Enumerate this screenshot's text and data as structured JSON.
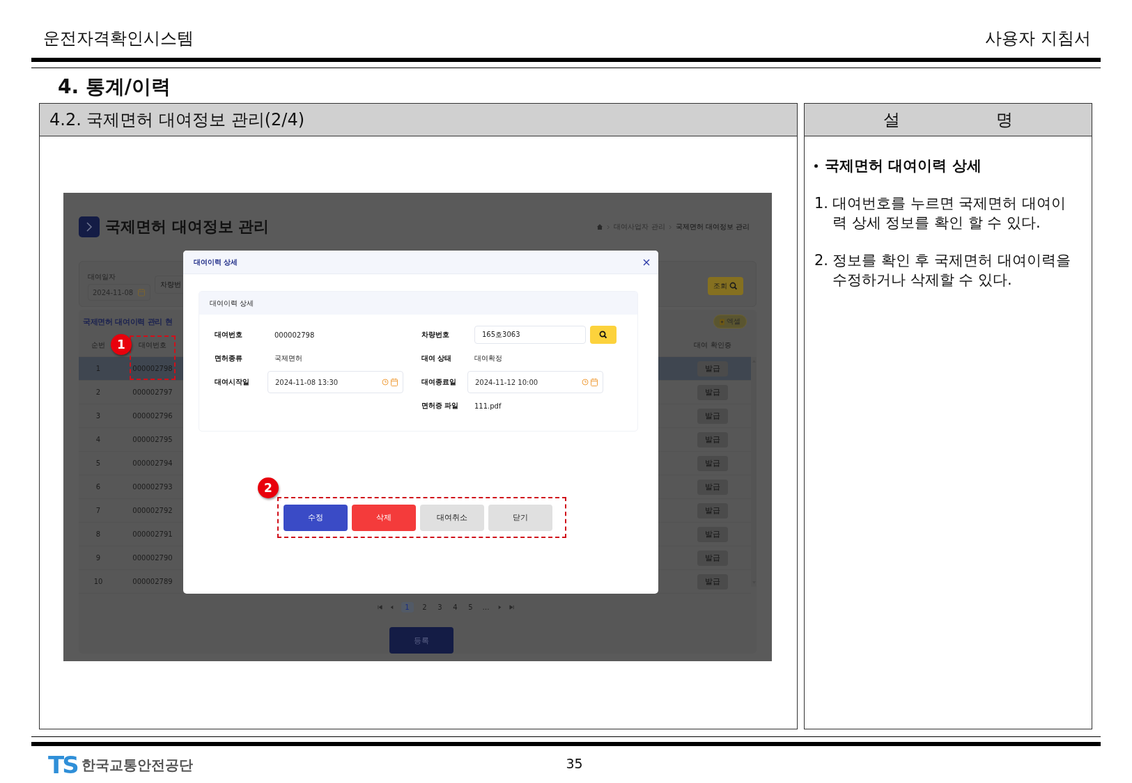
{
  "document_header": {
    "system_name": "운전자격확인시스템",
    "manual_title": "사용자 지침서"
  },
  "chapter_title": "4. 통계/이력",
  "left_panel": {
    "title": "4.2. 국제면허 대여정보 관리(2/4)",
    "app": {
      "page_title": "국제면허 대여정보 관리",
      "breadcrumb": [
        "대여사업자 관리",
        "국제면허 대여정보 관리"
      ],
      "filter": {
        "date_label": "대여일자",
        "date_value": "2024-11-08",
        "vehicle_placeholder": "차량번",
        "search_button": "조회"
      },
      "table": {
        "title": "국제면허 대여이력 관리 현",
        "excel_button": "엑셀",
        "columns": [
          "순번",
          "대여번호",
          "대여 확인증"
        ],
        "rows": [
          {
            "no": "1",
            "rental_no": "000002798",
            "action": "발급",
            "selected": true
          },
          {
            "no": "2",
            "rental_no": "000002797",
            "action": "발급",
            "selected": false
          },
          {
            "no": "3",
            "rental_no": "000002796",
            "action": "발급",
            "selected": false
          },
          {
            "no": "4",
            "rental_no": "000002795",
            "action": "발급",
            "selected": false
          },
          {
            "no": "5",
            "rental_no": "000002794",
            "action": "발급",
            "selected": false
          },
          {
            "no": "6",
            "rental_no": "000002793",
            "action": "발급",
            "selected": false
          },
          {
            "no": "7",
            "rental_no": "000002792",
            "action": "발급",
            "selected": false
          },
          {
            "no": "8",
            "rental_no": "000002791",
            "action": "발급",
            "selected": false
          },
          {
            "no": "9",
            "rental_no": "000002790",
            "action": "발급",
            "selected": false
          },
          {
            "no": "10",
            "rental_no": "000002789",
            "action": "발급",
            "selected": false
          }
        ]
      },
      "pagination": [
        {
          "label": "1",
          "selected": true
        },
        {
          "label": "2",
          "selected": false
        },
        {
          "label": "3",
          "selected": false
        },
        {
          "label": "4",
          "selected": false
        },
        {
          "label": "5",
          "selected": false
        },
        {
          "label": "…",
          "selected": false
        }
      ],
      "register_button": "등록",
      "modal": {
        "title": "대여이력 상세",
        "section_title": "대여이력 상세",
        "rows": [
          {
            "left": {
              "label": "대여번호",
              "value": "000002798",
              "kind": "text"
            },
            "right": {
              "label": "차량번호",
              "value": "165호3063",
              "kind": "search"
            }
          },
          {
            "left": {
              "label": "면허종류",
              "value": "국제면허",
              "kind": "text"
            },
            "right": {
              "label": "대여 상태",
              "value": "대여확정",
              "kind": "text"
            }
          },
          {
            "left": {
              "label": "대여시작일",
              "value": "2024-11-08 13:30",
              "kind": "datetime"
            },
            "right": {
              "label": "대여종료일",
              "value": "2024-11-12 10:00",
              "kind": "datetime"
            }
          },
          {
            "right": {
              "label": "면허증 파일",
              "value": "111.pdf",
              "kind": "text"
            }
          }
        ],
        "buttons": [
          {
            "label": "수정",
            "kind": "primary"
          },
          {
            "label": "삭제",
            "kind": "danger"
          },
          {
            "label": "대여취소",
            "kind": "default"
          },
          {
            "label": "닫기",
            "kind": "default"
          }
        ]
      },
      "annotations": [
        "1",
        "2"
      ]
    }
  },
  "right_panel": {
    "title": "설 명",
    "heading": "국제면허 대여이력 상세",
    "steps": [
      {
        "number": "1.",
        "text": "대여번호를 누르면 국제면허 대여이력 상세 정보를 확인 할 수 있다."
      },
      {
        "number": "2.",
        "text": "정보를 확인 후 국제면허 대여이력을 수정하거나 삭제할 수 있다."
      }
    ]
  },
  "footer": {
    "logo_text": "TS",
    "organization": "한국교통안전공단",
    "page_number": "35"
  }
}
